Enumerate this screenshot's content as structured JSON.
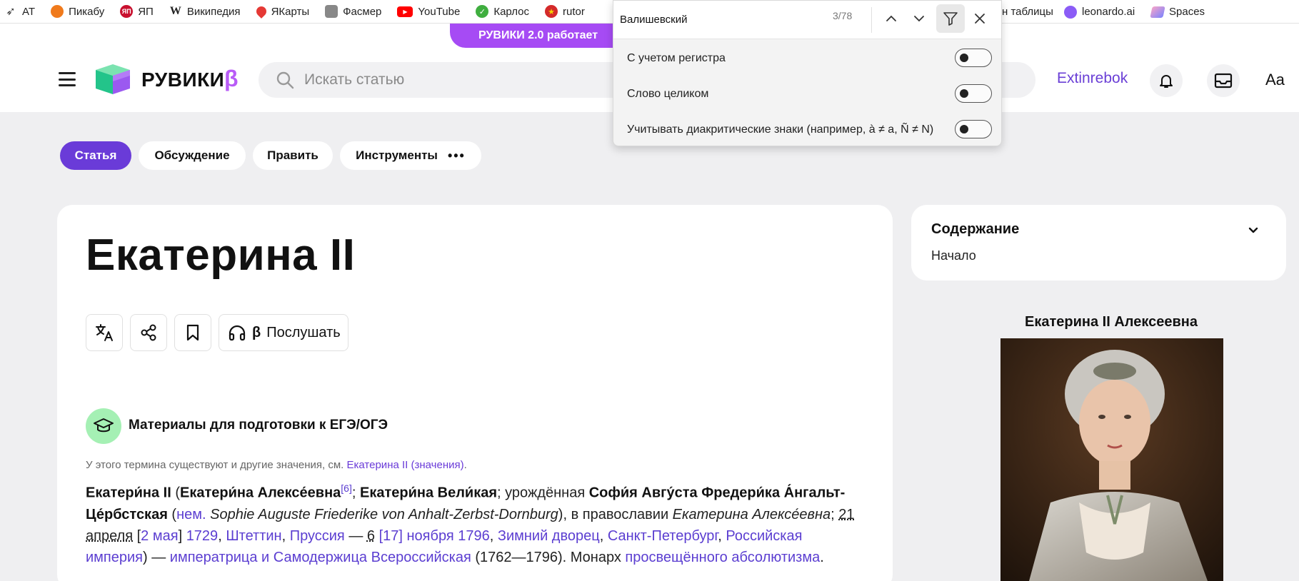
{
  "browser": {
    "bookmarks": [
      {
        "label": "AT",
        "icon": "at-icon",
        "color": "#333333"
      },
      {
        "label": "Пикабу",
        "icon": "pikabu-icon",
        "color": "#f07a1c"
      },
      {
        "label": "ЯП",
        "icon": "yap-icon",
        "color": "#c8102e"
      },
      {
        "label": "Википедия",
        "icon": "wikipedia-icon",
        "color": "#222222"
      },
      {
        "label": "ЯКарты",
        "icon": "map-pin-icon",
        "color": "#e53935"
      },
      {
        "label": "Фасмер",
        "icon": "fasmer-icon",
        "color": "#777777"
      },
      {
        "label": "YouTube",
        "icon": "youtube-icon",
        "color": "#ff0000"
      },
      {
        "label": "Карлос",
        "icon": "check-icon",
        "color": "#3fae3f"
      },
      {
        "label": "rutor",
        "icon": "rutor-icon",
        "color": "#d42a2a"
      }
    ],
    "bookmarks_right": [
      {
        "label": "н таблицы",
        "icon": ""
      },
      {
        "label": "leonardo.ai",
        "icon": "leonardo-icon",
        "color": "#8b5cf6"
      },
      {
        "label": "Spaces",
        "icon": "spaces-icon",
        "color": "#7c83fd"
      }
    ]
  },
  "find_panel": {
    "query": "Валишевский",
    "count": "3/78",
    "options": [
      {
        "label": "С учетом регистра",
        "enabled": false
      },
      {
        "label": "Слово целиком",
        "enabled": false
      },
      {
        "label": "Учитывать диакритические знаки (например, à ≠ a, Ñ ≠ N)",
        "enabled": false
      }
    ]
  },
  "header": {
    "promo": "РУВИКИ 2.0 работает",
    "logo_text": "РУВИКИ",
    "logo_beta": "β",
    "search_placeholder": "Искать статью",
    "username": "Extinrebok",
    "font_button": "Aa"
  },
  "tabs": [
    {
      "label": "Статья",
      "active": true
    },
    {
      "label": "Обсуждение",
      "active": false
    },
    {
      "label": "Править",
      "active": false
    },
    {
      "label": "Инструменты",
      "active": false
    }
  ],
  "article": {
    "title": "Екатерина II",
    "listen_beta": "β",
    "listen_label": "Послушать",
    "materials": "Материалы для подготовки к ЕГЭ/ОГЭ",
    "hatnote_prefix": "У этого термина существуют и другие значения, см.",
    "hatnote_link": "Екатерина II (значения)",
    "hatnote_suffix": ".",
    "lead": {
      "n1": "Екатери́на II",
      "t1": " (",
      "n2": "Екатери́на Алексе́евна",
      "ref": "[6]",
      "t2": "; ",
      "n3": "Екатери́на Вели́кая",
      "t3": "; урождённая ",
      "n4": "Софи́я Авгу́ста Фредери́ка А́нгальт-Це́рбстская",
      "t4": " (",
      "lang": "нем.",
      "german": " Sophie Auguste Friederike von Anhalt-Zerbst-Dornburg",
      "t5": "), в православии ",
      "orth": "Екатерина Алексе́евна",
      "t6": "; ",
      "date1": "21 апреля",
      "t7": " [",
      "date2": "2 мая",
      "t8": "] ",
      "year1": "1729",
      "t9": ", ",
      "place1": "Штеттин",
      "t10": ", ",
      "place2": "Пруссия",
      "t11": " — ",
      "date3": "6",
      "t12": " ",
      "date4": "[17] ноября 1796",
      "t13": ", ",
      "place3": "Зимний дворец",
      "t14": ", ",
      "place4": "Санкт-Петербург",
      "t15": ", ",
      "place5": "Российская империя",
      "t16": ") — ",
      "title_link": "императрица и Самодержица Всероссийская",
      "t17": " (1762—1796). Монарх ",
      "abs": "просвещённого абсолютизма",
      "t18": "."
    }
  },
  "toc": {
    "title": "Содержание",
    "items": [
      "Начало"
    ]
  },
  "infobox": {
    "caption": "Екатерина II Алексеевна"
  },
  "colors": {
    "accent": "#6a3bd8",
    "brand_purple": "#a64bf4",
    "link": "#5b3ed1",
    "background": "#efeff1"
  }
}
